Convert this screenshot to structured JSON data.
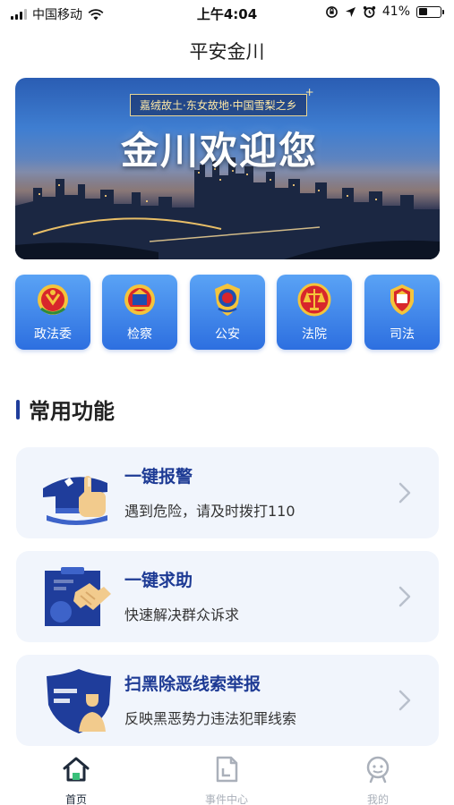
{
  "status_bar": {
    "carrier": "中国移动",
    "time": "上午4:04",
    "battery": "41%",
    "battery_level": 0.41
  },
  "header": {
    "title": "平安金川"
  },
  "banner": {
    "tag": "嘉绒故土·东女故地·中国雪梨之乡",
    "headline": "金川欢迎您"
  },
  "quick_links": [
    {
      "label": "政法委",
      "icon": "cpc-emblem-icon"
    },
    {
      "label": "检察",
      "icon": "procuratorate-emblem-icon"
    },
    {
      "label": "公安",
      "icon": "police-badge-icon"
    },
    {
      "label": "法院",
      "icon": "court-emblem-icon"
    },
    {
      "label": "司法",
      "icon": "justice-emblem-icon"
    }
  ],
  "section": {
    "title": "常用功能"
  },
  "features": [
    {
      "title": "一键报警",
      "desc": "遇到危险，请及时拨打110",
      "icon": "police-alarm-icon"
    },
    {
      "title": "一键求助",
      "desc": "快速解决群众诉求",
      "icon": "handshake-help-icon"
    },
    {
      "title": "扫黑除恶线索举报",
      "desc": "反映黑恶势力违法犯罪线索",
      "icon": "shield-report-icon"
    }
  ],
  "tabs": [
    {
      "label": "首页",
      "icon": "home-icon",
      "active": true
    },
    {
      "label": "事件中心",
      "icon": "document-icon",
      "active": false
    },
    {
      "label": "我的",
      "icon": "profile-icon",
      "active": false
    }
  ],
  "colors": {
    "accent": "#1f3d9b",
    "tile": "#3d86ea",
    "card_bg": "#f1f5fc"
  }
}
